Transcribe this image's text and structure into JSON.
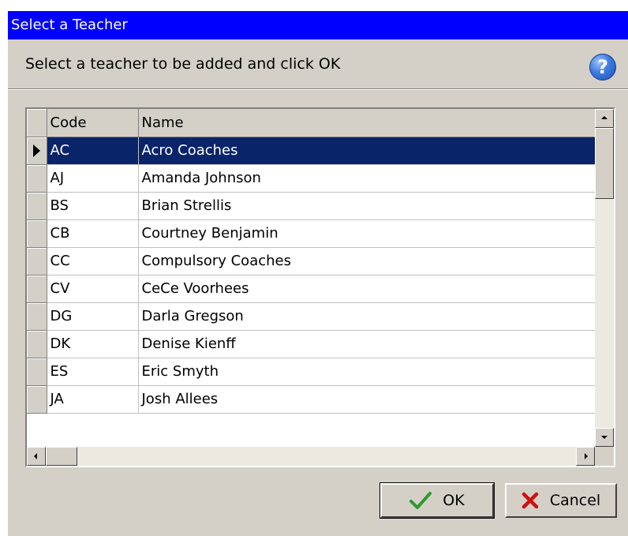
{
  "dialog": {
    "title": "Select a Teacher",
    "instruction": "Select a teacher to be added and click OK",
    "help_icon": "help-question-icon"
  },
  "grid": {
    "columns": [
      "Code",
      "Name"
    ],
    "selected_index": 0,
    "rows": [
      {
        "code": "AC",
        "name": "Acro Coaches"
      },
      {
        "code": "AJ",
        "name": "Amanda Johnson"
      },
      {
        "code": "BS",
        "name": "Brian Strellis"
      },
      {
        "code": "CB",
        "name": "Courtney Benjamin"
      },
      {
        "code": "CC",
        "name": "Compulsory Coaches"
      },
      {
        "code": "CV",
        "name": "CeCe Voorhees"
      },
      {
        "code": "DG",
        "name": "Darla Gregson"
      },
      {
        "code": "DK",
        "name": "Denise Kienff"
      },
      {
        "code": "ES",
        "name": "Eric Smyth"
      },
      {
        "code": "JA",
        "name": "Josh Allees"
      }
    ]
  },
  "buttons": {
    "ok_label": "OK",
    "cancel_label": "Cancel",
    "ok_icon": "checkmark-icon",
    "cancel_icon": "x-icon"
  },
  "colors": {
    "title_bar": "#0000ff",
    "selection": "#0a246a",
    "ok_check": "#2e9b2e",
    "cancel_x": "#d01010"
  }
}
